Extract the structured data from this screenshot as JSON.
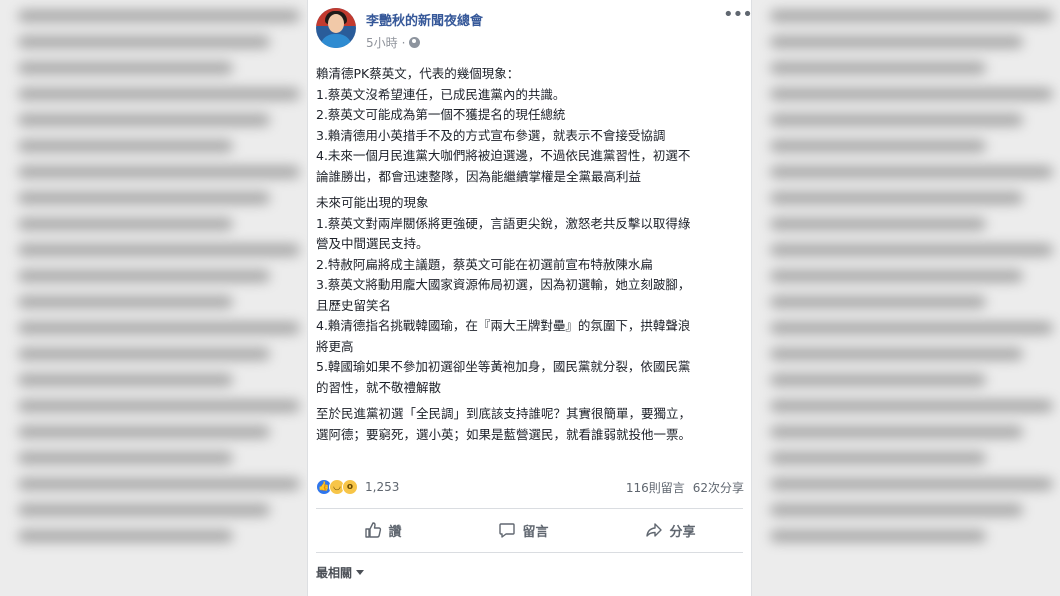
{
  "post": {
    "page_name": "李艷秋的新聞夜總會",
    "time": "5小時",
    "separator": "·",
    "paragraphs": [
      {
        "lines": [
          "賴清德PK蔡英文，代表的幾個現象：",
          "1.蔡英文沒希望連任，已成民進黨內的共識。",
          "2.蔡英文可能成為第一個不獲提名的現任總統",
          "3.賴清德用小英措手不及的方式宣布參選，就表示不會接受協調",
          "4.未來一個月民進黨大咖們將被迫選邊，不過依民進黨習性，初選不",
          "論誰勝出，都會迅速整隊，因為能繼續掌權是全黨最高利益"
        ]
      },
      {
        "lines": [
          "未來可能出現的現象",
          "1.蔡英文對兩岸關係將更強硬，言語更尖銳，激怒老共反擊以取得綠",
          "營及中間選民支持。",
          "2.特赦阿扁將成主議題，蔡英文可能在初選前宣布特赦陳水扁",
          "3.蔡英文將動用龐大國家資源佈局初選，因為初選輸，她立刻跛腳，",
          "且歷史留笑名",
          "4.賴清德指名挑戰韓國瑜，在『兩大王牌對壘』的氛圍下，拱韓聲浪",
          "將更高",
          "5.韓國瑜如果不參加初選卻坐等黃袍加身，國民黨就分裂，依國民黨",
          "的習性，就不敬禮解散"
        ]
      },
      {
        "lines": [
          "至於民進黨初選「全民調」到底該支持誰呢？其實很簡單，要獨立，",
          "選阿德；要窮死，選小英；如果是藍營選民，就看誰弱就投他一票。"
        ]
      }
    ],
    "reaction_count": "1,253",
    "comments": "116則留言",
    "shares": "62次分享"
  },
  "actions": {
    "like": "讚",
    "comment": "留言",
    "share": "分享"
  },
  "sort_label": "最相關",
  "colors": {
    "page_name": "#365899",
    "like": "#2f76ed",
    "text": "#1d2129",
    "muted": "#606770"
  }
}
